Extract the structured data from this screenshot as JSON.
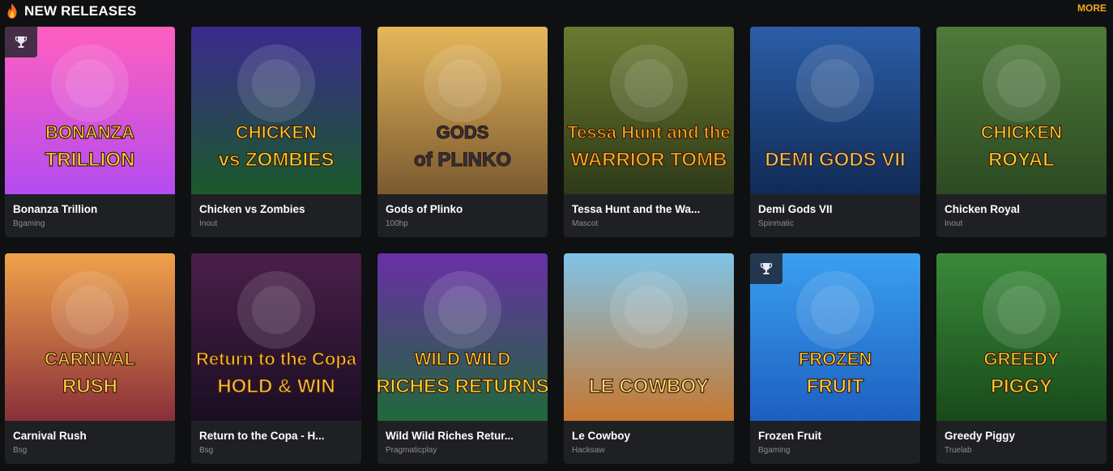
{
  "header": {
    "title": "NEW RELEASES",
    "more_label": "MORE",
    "icon": "fire-icon"
  },
  "colors": {
    "accent": "#f5a623",
    "card_bg": "#1f2024",
    "page_bg": "#0f1012",
    "provider_text": "#8a8c93"
  },
  "games": [
    {
      "name": "Bonanza Trillion",
      "provider": "Bgaming",
      "trophy": true,
      "art_text": [
        "BONANZA",
        "TRILLION"
      ],
      "bg": [
        "#ff5fbf",
        "#b44cf0"
      ],
      "fg": "#ffd23a"
    },
    {
      "name": "Chicken vs Zombies",
      "provider": "Inout",
      "trophy": false,
      "art_text": [
        "CHICKEN",
        "vs ZOMBIES"
      ],
      "bg": [
        "#3b2a8f",
        "#1a5a2a"
      ],
      "fg": "#ffd32a"
    },
    {
      "name": "Gods of Plinko",
      "provider": "100hp",
      "trophy": false,
      "art_text": [
        "GODS",
        "of PLINKO"
      ],
      "bg": [
        "#e6b75a",
        "#7a5a30"
      ],
      "fg": "#2a3550"
    },
    {
      "name": "Tessa Hunt and the Wa...",
      "provider": "Mascot",
      "trophy": false,
      "art_text": [
        "Tessa Hunt and the",
        "WARRIOR TOMB"
      ],
      "bg": [
        "#6b7a30",
        "#2e3a18"
      ],
      "fg": "#ffb21f"
    },
    {
      "name": "Demi Gods VII",
      "provider": "Spinmatic",
      "trophy": false,
      "art_text": [
        "",
        "DEMI GODS VII"
      ],
      "bg": [
        "#2b5ea8",
        "#102a55"
      ],
      "fg": "#e8c66a"
    },
    {
      "name": "Chicken Royal",
      "provider": "Inout",
      "trophy": false,
      "art_text": [
        "CHICKEN",
        "ROYAL"
      ],
      "bg": [
        "#4e7a3a",
        "#2c4a22"
      ],
      "fg": "#ffcf2a"
    },
    {
      "name": "Carnival Rush",
      "provider": "Bsg",
      "trophy": false,
      "art_text": [
        "CARNIVAL",
        "RUSH"
      ],
      "bg": [
        "#f0a24a",
        "#8a2f3a"
      ],
      "fg": "#ffd54a"
    },
    {
      "name": "Return to the Copa - H...",
      "provider": "Bsg",
      "trophy": false,
      "art_text": [
        "Return to the Copa",
        "HOLD & WIN"
      ],
      "bg": [
        "#4a1f4a",
        "#1a0e22"
      ],
      "fg": "#ffc23a"
    },
    {
      "name": "Wild Wild Riches Retur...",
      "provider": "Pragmaticplay",
      "trophy": false,
      "art_text": [
        "WILD WILD",
        "RICHES RETURNS"
      ],
      "bg": [
        "#6a2fa8",
        "#1f6a3a"
      ],
      "fg": "#ffd02a"
    },
    {
      "name": "Le Cowboy",
      "provider": "Hacksaw",
      "trophy": false,
      "art_text": [
        "",
        "LE COWBOY"
      ],
      "bg": [
        "#7fc4e8",
        "#c6772f"
      ],
      "fg": "#ffe06a"
    },
    {
      "name": "Frozen Fruit",
      "provider": "Bgaming",
      "trophy": true,
      "art_text": [
        "FROZEN",
        "FRUIT"
      ],
      "bg": [
        "#3aa0f0",
        "#1d5fc0"
      ],
      "fg": "#ffd23a"
    },
    {
      "name": "Greedy Piggy",
      "provider": "Truelab",
      "trophy": false,
      "art_text": [
        "GREEDY",
        "PIGGY"
      ],
      "bg": [
        "#3a8a3a",
        "#184a1a"
      ],
      "fg": "#ffcf2a"
    }
  ]
}
